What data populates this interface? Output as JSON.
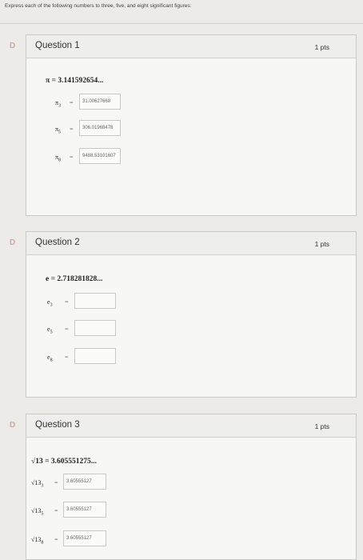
{
  "instruction": "Express each of the following numbers to three, five, and eight significant figures:",
  "flag_icon": "D",
  "questions": [
    {
      "title": "Question 1",
      "points": "1 pts",
      "given": "π = 3.141592654...",
      "rows": [
        {
          "label_base": "π",
          "label_sub": "3",
          "value": "31.00627668"
        },
        {
          "label_base": "π",
          "label_sub": "5",
          "value": "306.01968478"
        },
        {
          "label_base": "π",
          "label_sub": "8",
          "value": "9488.53101607"
        }
      ]
    },
    {
      "title": "Question 2",
      "points": "1 pts",
      "given": "e = 2.718281828...",
      "rows": [
        {
          "label_base": "e",
          "label_sub": "3",
          "value": ""
        },
        {
          "label_base": "e",
          "label_sub": "5",
          "value": ""
        },
        {
          "label_base": "e",
          "label_sub": "8",
          "value": ""
        }
      ]
    },
    {
      "title": "Question 3",
      "points": "1 pts",
      "given": "√13 = 3.605551275...",
      "rows": [
        {
          "label_base": "√13",
          "label_sub": "3",
          "value": "3.60555127"
        },
        {
          "label_base": "√13",
          "label_sub": "5",
          "value": "3.60555127"
        },
        {
          "label_base": "√13",
          "label_sub": "8",
          "value": "3.60555127"
        }
      ]
    }
  ]
}
